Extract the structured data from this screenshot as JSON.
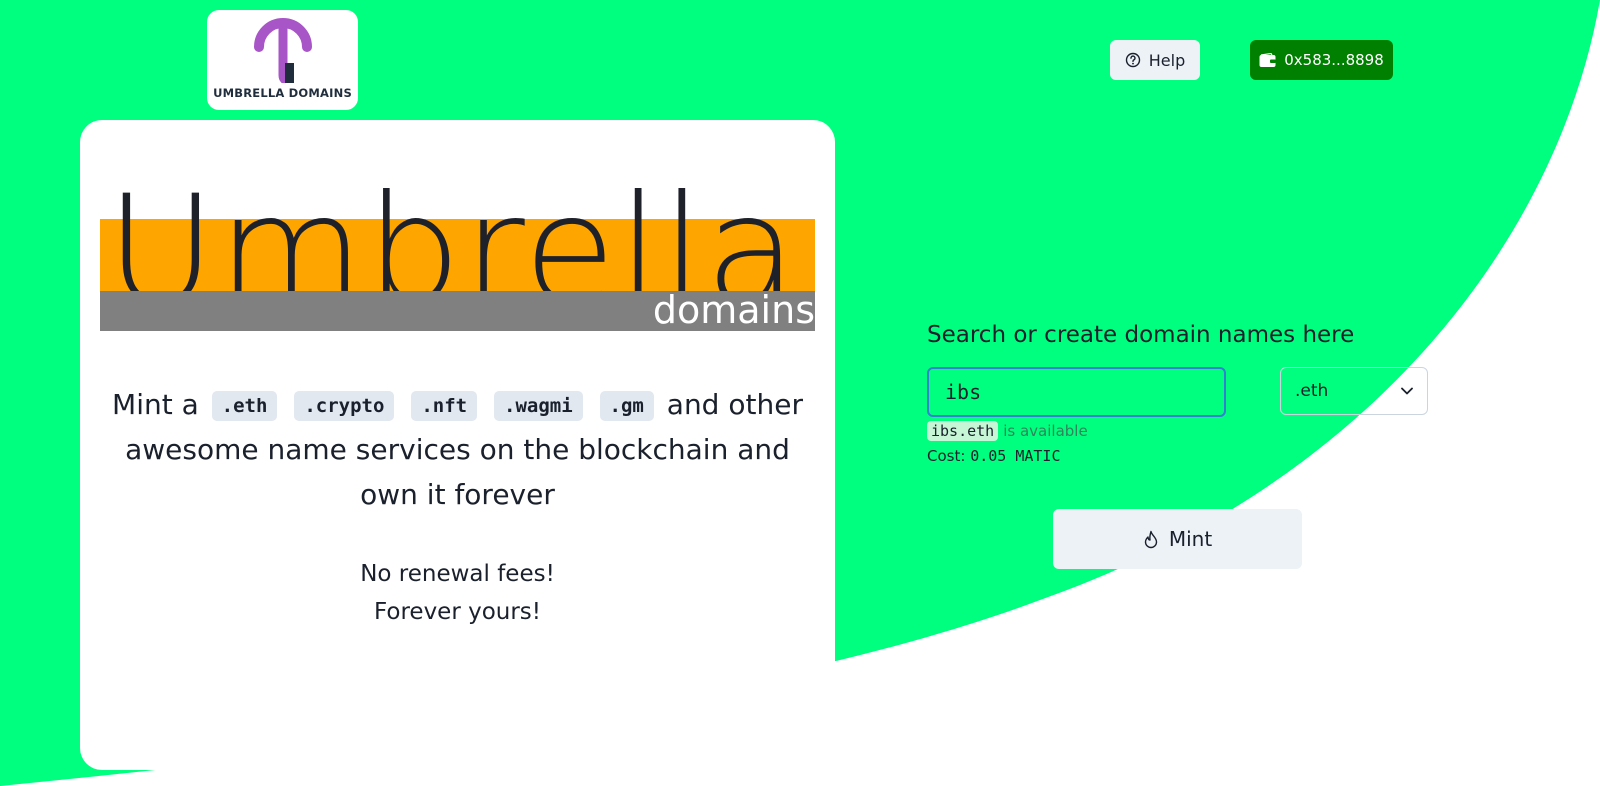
{
  "colors": {
    "brand_green": "#00ff7f",
    "wallet_green": "#008000",
    "banner_orange": "#ffa500",
    "banner_gray": "#808080",
    "logo_purple": "#a855c7"
  },
  "header": {
    "logo_text": "UMBRELLA DOMAINS",
    "help_label": "Help",
    "help_icon": "question-circle-icon",
    "wallet_label": "0x583...8898",
    "wallet_icon": "wallet-icon"
  },
  "hero": {
    "banner_big": "Umbrella",
    "banner_small": "domains",
    "tagline_prefix": "Mint a",
    "tlds": [
      ".eth",
      ".crypto",
      ".nft",
      ".wagmi",
      ".gm"
    ],
    "tagline_suffix": "and other awesome name services on the blockchain and own it forever",
    "perk_1": "No renewal fees!",
    "perk_2": "Forever yours!"
  },
  "search": {
    "title": "Search or create domain names here",
    "input_value": "ibs",
    "selected_tld": ".eth",
    "available_domain": "ibs.eth",
    "available_text": "is available",
    "cost_label": "Cost:",
    "cost_value": "0.05 MATIC",
    "mint_label": "Mint",
    "mint_icon": "flame-icon"
  }
}
